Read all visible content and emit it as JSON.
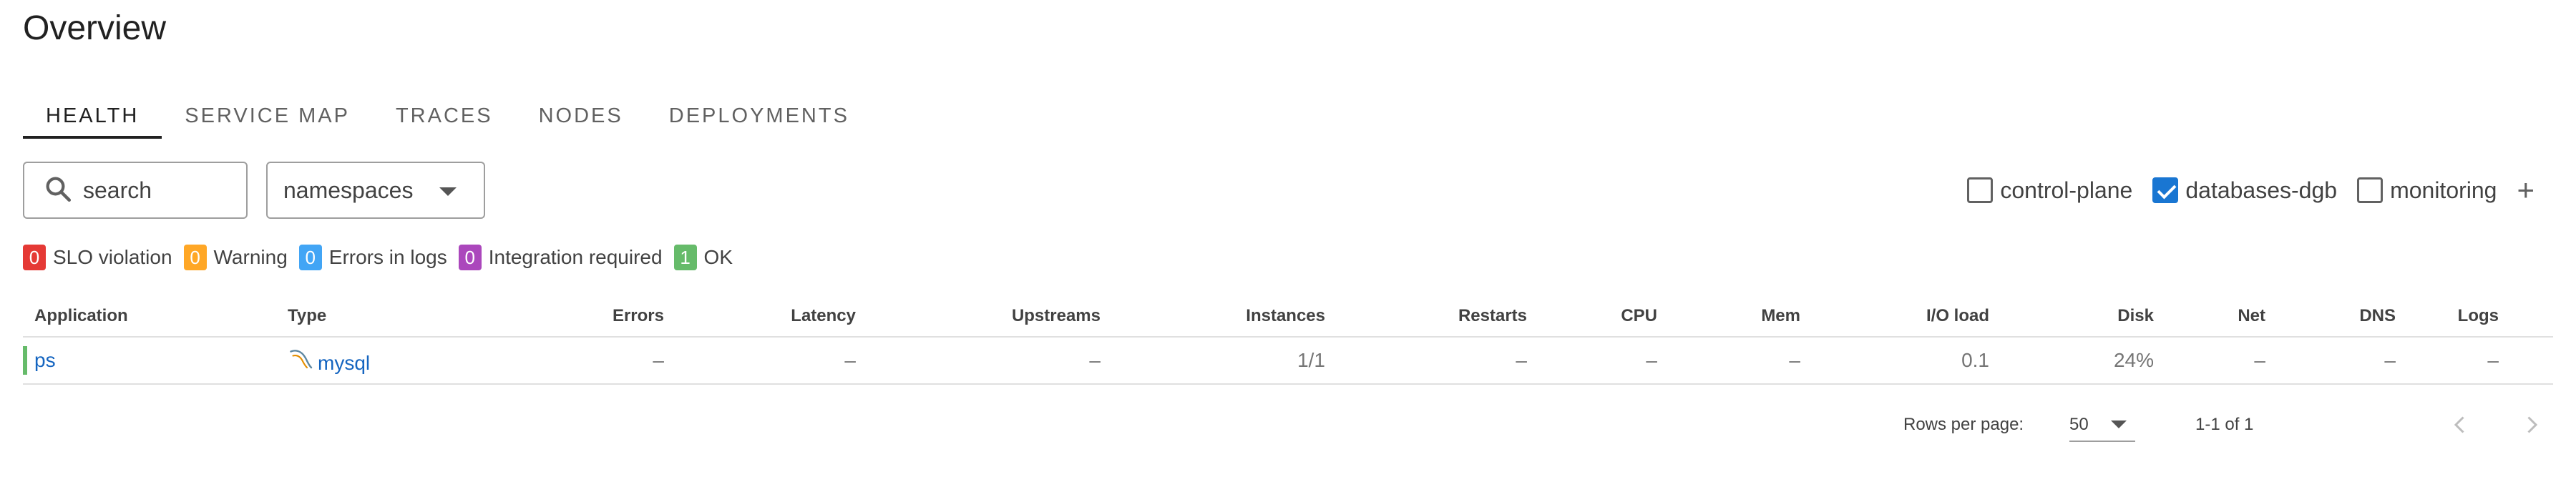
{
  "page": {
    "title": "Overview"
  },
  "tabs": [
    {
      "label": "HEALTH",
      "active": true
    },
    {
      "label": "SERVICE MAP",
      "active": false
    },
    {
      "label": "TRACES",
      "active": false
    },
    {
      "label": "NODES",
      "active": false
    },
    {
      "label": "DEPLOYMENTS",
      "active": false
    }
  ],
  "filters": {
    "search_placeholder": "search",
    "search_value": "",
    "namespaces_label": "namespaces"
  },
  "namespace_checks": [
    {
      "label": "control-plane",
      "checked": false
    },
    {
      "label": "databases-dgb",
      "checked": true
    },
    {
      "label": "monitoring",
      "checked": false
    }
  ],
  "summary": [
    {
      "count": "0",
      "label": "SLO violation",
      "color": "#e53935"
    },
    {
      "count": "0",
      "label": "Warning",
      "color": "#ffa726"
    },
    {
      "count": "0",
      "label": "Errors in logs",
      "color": "#42a5f5"
    },
    {
      "count": "0",
      "label": "Integration required",
      "color": "#ab47bc"
    },
    {
      "count": "1",
      "label": "OK",
      "color": "#66bb6a"
    }
  ],
  "table": {
    "columns": [
      "Application",
      "Type",
      "Errors",
      "Latency",
      "Upstreams",
      "Instances",
      "Restarts",
      "CPU",
      "Mem",
      "I/O load",
      "Disk",
      "Net",
      "DNS",
      "Logs"
    ],
    "rows": [
      {
        "status_color": "#66bb6a",
        "cells": [
          "ps",
          "mysql",
          "–",
          "–",
          "–",
          "1/1",
          "–",
          "–",
          "–",
          "0.1",
          "24%",
          "–",
          "–",
          "–"
        ],
        "type_icon": "mysql-icon"
      }
    ]
  },
  "pagination": {
    "rows_per_page_label": "Rows per page:",
    "rows_per_page": "50",
    "range": "1-1 of 1"
  },
  "colors": {
    "accent": "#1976d2",
    "link": "#1565c0"
  }
}
